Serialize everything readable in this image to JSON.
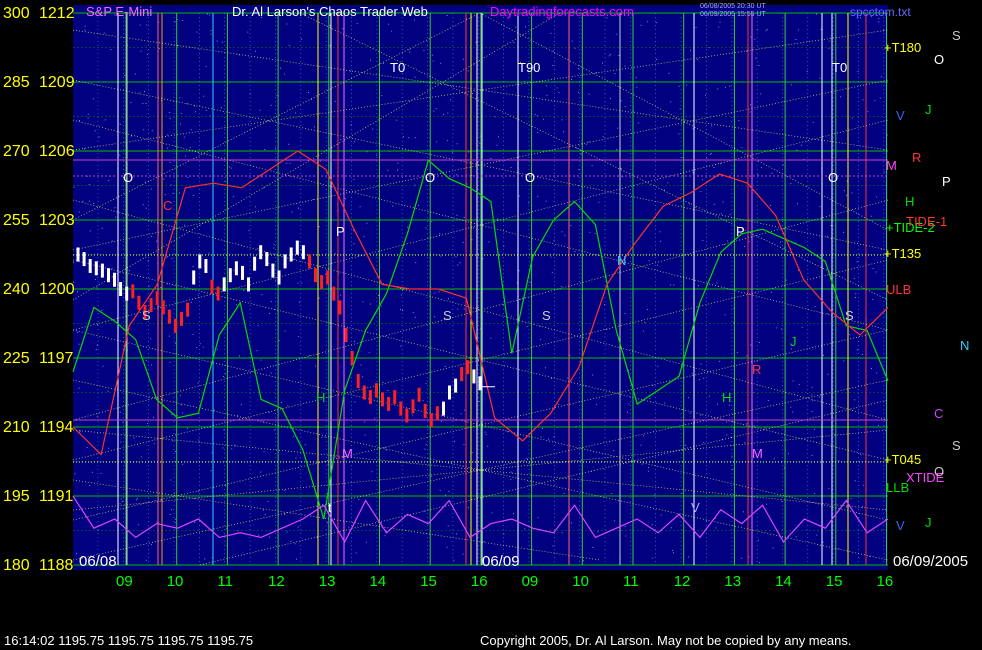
{
  "header": {
    "left_title": "S&P E-Mini",
    "center_title": "Dr. Al Larson's Chaos Trader Web",
    "site": "Daytradingforecasts.com",
    "timestamps": [
      "06/08/2005 20:30 UT",
      "06/09/2005 15:55 UT"
    ],
    "file": "spcctom.txt"
  },
  "footer": {
    "quote": "16:14:02  1195.75 1195.75 1195.75 1195.75",
    "copyright": "Copyright 2005, Dr. Al Larson. May not be copied by any means."
  },
  "colors": {
    "background": "#000000",
    "panel": "#000080",
    "price_axis": "#ffff00",
    "grid": "#00c000",
    "hour_labels": "#00ff00",
    "titles": "#ff66ff",
    "site": "#ff00ff",
    "up_bar": "#ffffff",
    "down_bar": "#ff0000"
  },
  "chart_data": {
    "type": "line",
    "title": "S&P E-Mini",
    "y_axis": {
      "left_labels": [
        "300",
        "285",
        "270",
        "255",
        "240",
        "225",
        "210",
        "195",
        "180"
      ],
      "price_labels": [
        "1212",
        "1209",
        "1206",
        "1203",
        "1200",
        "1197",
        "1194",
        "1191",
        "1188"
      ],
      "price_range": [
        1188,
        1212
      ]
    },
    "x_axis": {
      "hour_labels": [
        "09",
        "10",
        "11",
        "12",
        "13",
        "14",
        "15",
        "16",
        "09",
        "10",
        "11",
        "12",
        "13",
        "14",
        "15",
        "16"
      ],
      "date_labels": [
        "06/08",
        "06/09",
        "06/09/2005"
      ]
    },
    "annotations": {
      "markers": [
        "T0",
        "T90",
        "T0",
        "O",
        "O",
        "O",
        "O",
        "P",
        "P",
        "S",
        "S",
        "S",
        "S",
        "N",
        "H",
        "H",
        "M",
        "M",
        "R",
        "C",
        "J",
        "V",
        "t"
      ],
      "right_labels": [
        "+T180",
        "+T135",
        "ULB",
        "+TIDE-2",
        "TIDE-1",
        "+T045",
        "LLB",
        "XTIDE",
        "M",
        "R",
        "H",
        "P",
        "O",
        "J",
        "V",
        "N",
        "C",
        "S",
        "S",
        "O",
        "J",
        "V"
      ]
    },
    "price_series": {
      "name": "ES price",
      "session": "06/08-06/09",
      "values": [
        1201.5,
        1201.3,
        1201.0,
        1200.9,
        1200.8,
        1200.6,
        1200.4,
        1200.0,
        1199.8,
        1199.9,
        1199.4,
        1199.0,
        1199.3,
        1199.6,
        1199.2,
        1198.8,
        1198.4,
        1198.7,
        1199.1,
        1200.5,
        1201.2,
        1201.0,
        1200.1,
        1199.8,
        1200.2,
        1200.6,
        1200.9,
        1200.7,
        1200.2,
        1201.1,
        1201.6,
        1201.3,
        1200.8,
        1200.5,
        1201.2,
        1201.5,
        1201.8,
        1201.6,
        1201.2,
        1200.6,
        1200.3,
        1200.5,
        1199.8,
        1199.2,
        1198.0,
        1197.0,
        1196.0,
        1195.5,
        1195.3,
        1195.6,
        1195.2,
        1195.0,
        1195.3,
        1194.8,
        1194.5,
        1194.9,
        1195.4,
        1194.7,
        1194.3,
        1194.6,
        1194.8,
        1195.5,
        1195.8,
        1196.3,
        1196.6,
        1196.2,
        1195.9
      ]
    },
    "price_bar_colors": [
      "W",
      "W",
      "W",
      "W",
      "W",
      "W",
      "W",
      "W",
      "W",
      "R",
      "R",
      "R",
      "R",
      "R",
      "R",
      "R",
      "R",
      "R",
      "R",
      "W",
      "W",
      "W",
      "R",
      "R",
      "W",
      "W",
      "W",
      "W",
      "W",
      "W",
      "W",
      "W",
      "W",
      "W",
      "W",
      "W",
      "W",
      "W",
      "R",
      "R",
      "R",
      "R",
      "R",
      "R",
      "R",
      "R",
      "R",
      "R",
      "R",
      "R",
      "R",
      "R",
      "R",
      "R",
      "R",
      "R",
      "R",
      "R",
      "R",
      "R",
      "W",
      "W",
      "W",
      "R",
      "R",
      "W",
      "W"
    ],
    "curves": [
      {
        "name": "TIDE-2",
        "color": "#00dd00",
        "values": [
          222,
          236,
          233,
          229,
          216,
          212,
          213,
          230,
          237,
          216,
          214,
          205,
          190,
          218,
          231,
          239,
          252,
          268,
          264,
          262,
          259,
          226,
          247,
          255,
          259,
          254,
          231,
          215,
          218,
          221,
          237,
          248,
          252,
          253,
          251,
          249,
          246,
          232,
          231,
          220
        ]
      },
      {
        "name": "TIDE-1",
        "color": "#ff3030",
        "values": [
          210,
          204,
          232,
          241,
          262,
          263,
          262,
          266,
          270,
          266,
          253,
          241,
          240,
          240,
          238,
          212,
          207,
          213,
          223,
          241,
          250,
          258,
          261,
          265,
          263,
          256,
          242,
          235,
          230,
          236
        ]
      },
      {
        "name": "XTIDE",
        "color": "#dd44ff",
        "values": [
          195,
          188,
          190,
          186,
          189,
          188,
          190,
          186,
          187,
          186,
          188,
          190,
          193,
          185,
          194,
          187,
          191,
          189,
          194,
          186,
          189,
          190,
          188,
          187,
          193,
          186,
          188,
          190,
          187,
          191,
          186,
          192,
          189,
          193,
          185,
          190,
          188,
          194,
          187,
          190
        ]
      }
    ]
  }
}
